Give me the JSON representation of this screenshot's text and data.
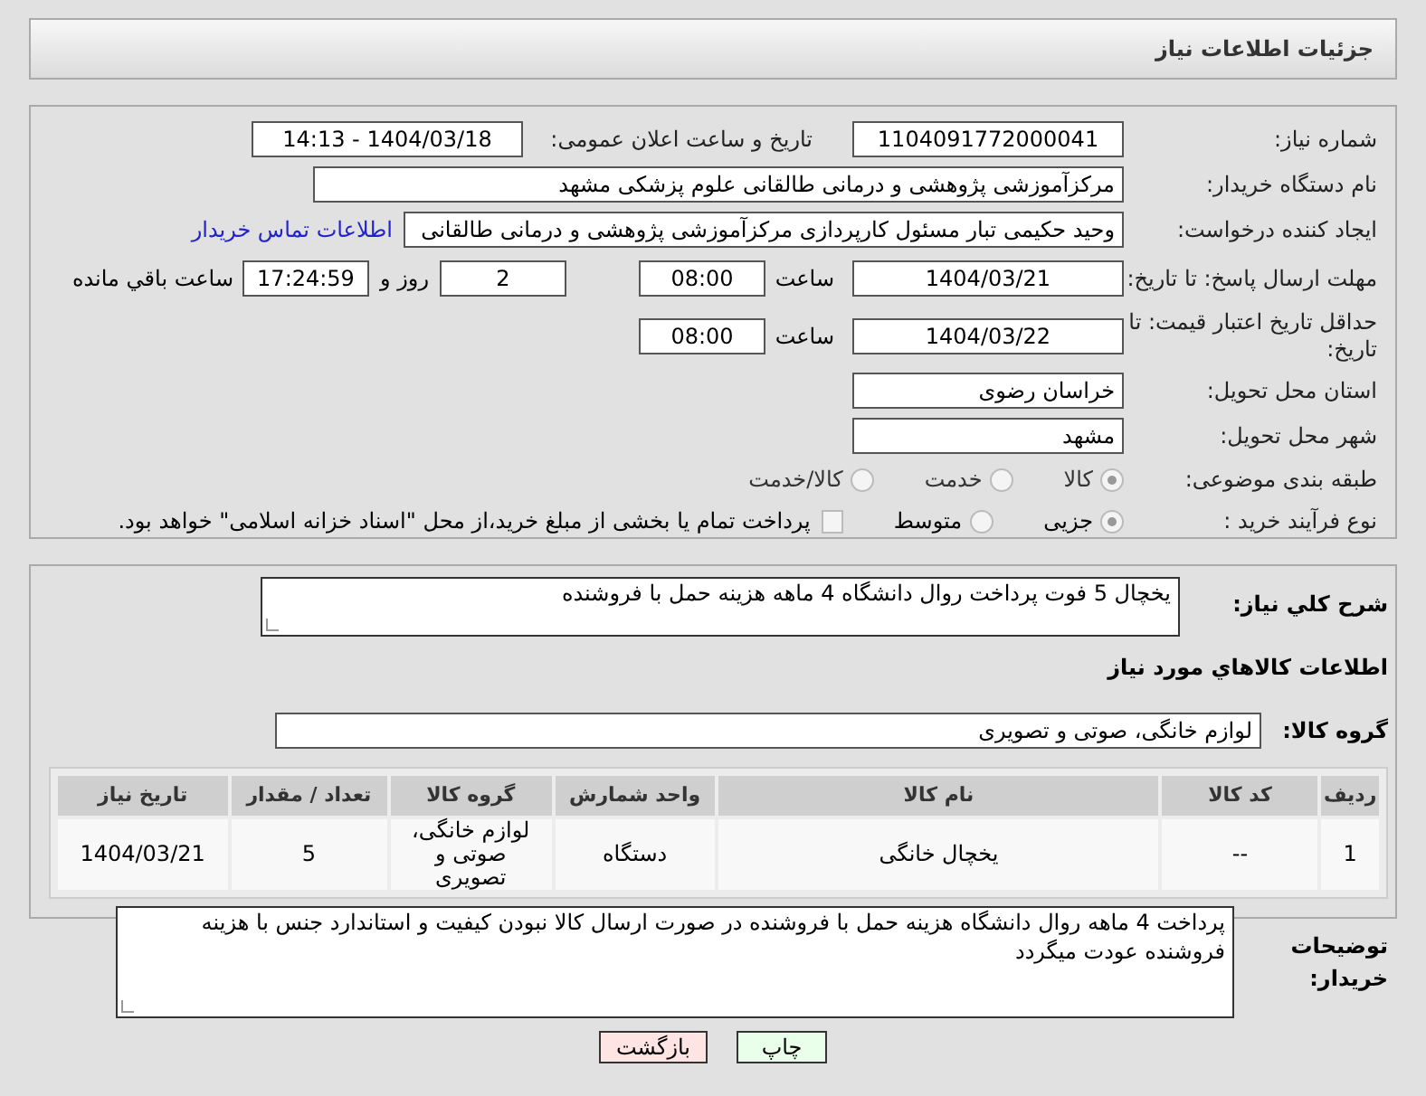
{
  "header": {
    "title": "جزئیات اطلاعات نیاز"
  },
  "details": {
    "need_number": {
      "label": "شماره نیاز:",
      "value": "1104091772000041"
    },
    "announce": {
      "label": "تاریخ و ساعت اعلان عمومی:",
      "value": "1404/03/18 - 14:13"
    },
    "buyer": {
      "label": "نام دستگاه خریدار:",
      "value": "مرکزآموزشی  پژوهشی و درمانی طالقانی   علوم پزشکی مشهد"
    },
    "creator": {
      "label": "ایجاد کننده درخواست:",
      "value": "وحید حکیمی تبار مسئول کارپردازی مرکزآموزشی  پژوهشی و درمانی طالقانی",
      "link": "اطلاعات تماس خریدار"
    },
    "deadline": {
      "label": "مهلت ارسال پاسخ: تا تاریخ:",
      "date": "1404/03/21",
      "time_label": "ساعت",
      "time": "08:00",
      "days": "2",
      "days_label": "روز و",
      "remaining": "17:24:59",
      "remaining_label": "ساعت باقي مانده"
    },
    "validity": {
      "label": "حداقل تاریخ اعتبار قیمت: تا تاریخ:",
      "date": "1404/03/22",
      "time_label": "ساعت",
      "time": "08:00"
    },
    "province": {
      "label": "استان محل تحویل:",
      "value": "خراسان رضوی"
    },
    "city": {
      "label": "شهر محل تحویل:",
      "value": "مشهد"
    },
    "category": {
      "label": "طبقه بندی موضوعی:",
      "options": [
        {
          "label": "کالا",
          "selected": true
        },
        {
          "label": "خدمت",
          "selected": false
        },
        {
          "label": "کالا/خدمت",
          "selected": false
        }
      ]
    },
    "process": {
      "label": "نوع فرآیند خرید :",
      "options": [
        {
          "label": "جزیی",
          "selected": true
        },
        {
          "label": "متوسط",
          "selected": false
        }
      ],
      "treasury": {
        "label": "پرداخت تمام یا بخشی از مبلغ خرید،از محل \"اسناد خزانه اسلامی\" خواهد بود.",
        "checked": false
      }
    }
  },
  "summary": {
    "label": "شرح کلي نياز:",
    "value": "یخچال 5 فوت پرداخت روال دانشگاه 4 ماهه هزینه حمل با فروشنده"
  },
  "goods": {
    "title": "اطلاعات کالاهاي مورد نياز",
    "group_label": "گروه کالا:",
    "group": "لوازم خانگی، صوتی و تصویری",
    "columns": [
      "ردیف",
      "کد کالا",
      "نام کالا",
      "واحد شمارش",
      "گروه کالا",
      "تعداد / مقدار",
      "تاریخ نیاز"
    ],
    "rows": [
      [
        "1",
        "--",
        "یخچال خانگی",
        "دستگاه",
        "لوازم خانگی، صوتی و تصویری",
        "5",
        "1404/03/21"
      ]
    ]
  },
  "notes": {
    "label": "توضیحات خریدار:",
    "value": "پرداخت 4 ماهه روال دانشگاه هزینه حمل با فروشنده در صورت ارسال کالا نبودن کیفیت و استاندارد جنس با هزینه فروشنده عودت میگردد"
  },
  "buttons": [
    {
      "label": "چاپ",
      "kind": "print"
    },
    {
      "label": "بازگشت",
      "kind": "back"
    }
  ]
}
